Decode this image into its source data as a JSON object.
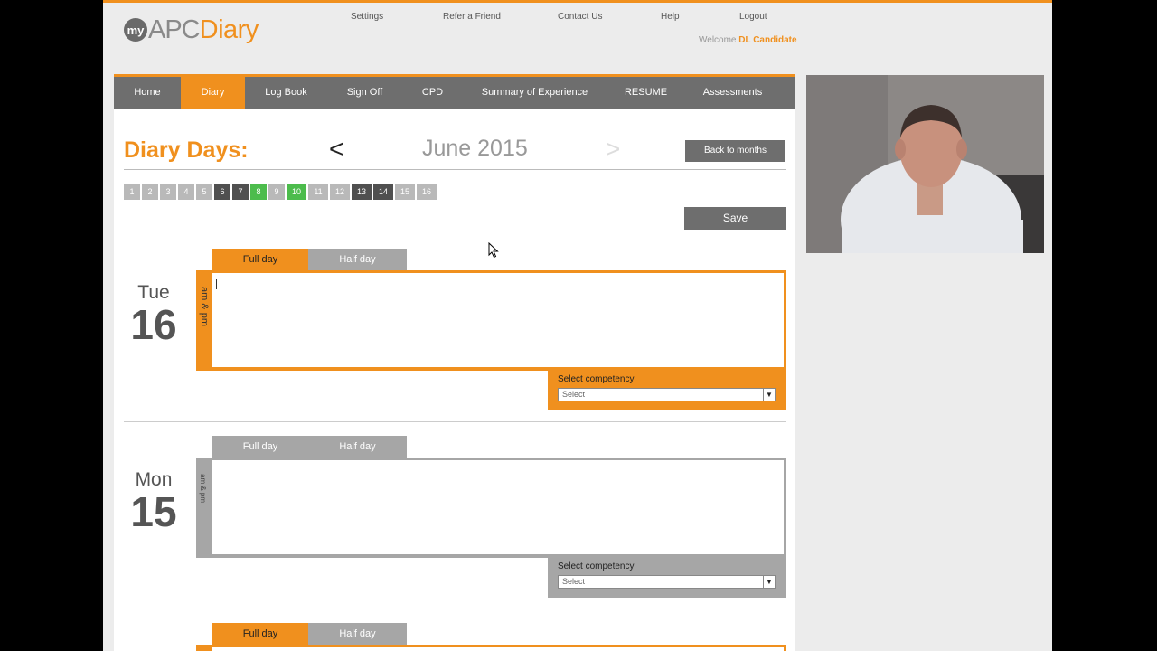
{
  "brand": {
    "my": "my",
    "apc": "APC",
    "diary": "Diary"
  },
  "top_links": [
    "Settings",
    "Refer a Friend",
    "Contact Us",
    "Help",
    "Logout"
  ],
  "welcome": {
    "prefix": "Welcome",
    "user": "DL Candidate"
  },
  "nav": [
    "Home",
    "Diary",
    "Log Book",
    "Sign Off",
    "CPD",
    "Summary of Experience",
    "RESUME",
    "Assessments"
  ],
  "nav_active": "Diary",
  "diary": {
    "title": "Diary Days:",
    "prev": "<",
    "month": "June 2015",
    "next": ">",
    "back_button": "Back to months",
    "save_button": "Save",
    "days": [
      "1",
      "2",
      "3",
      "4",
      "5",
      "6",
      "7",
      "8",
      "9",
      "10",
      "11",
      "12",
      "13",
      "14",
      "15",
      "16"
    ],
    "day_states": [
      "empty",
      "empty",
      "empty",
      "empty",
      "empty",
      "dark",
      "dark",
      "green",
      "empty",
      "green",
      "empty",
      "empty",
      "dark",
      "dark",
      "empty",
      "empty"
    ]
  },
  "entries": [
    {
      "weekday": "Tue",
      "day": "16",
      "full_tab": "Full day",
      "half_tab": "Half day",
      "period": "am & pm",
      "competency_label": "Select competency",
      "competency_value": "Select",
      "active": true
    },
    {
      "weekday": "Mon",
      "day": "15",
      "full_tab": "Full day",
      "half_tab": "Half day",
      "period": "am & pm",
      "competency_label": "Select competency",
      "competency_value": "Select",
      "active": false
    },
    {
      "full_tab": "Full day",
      "half_tab": "Half day"
    }
  ],
  "colors": {
    "accent": "#f0901e",
    "nav_bg": "#6e6e6e",
    "complete": "#4cbc4c"
  }
}
